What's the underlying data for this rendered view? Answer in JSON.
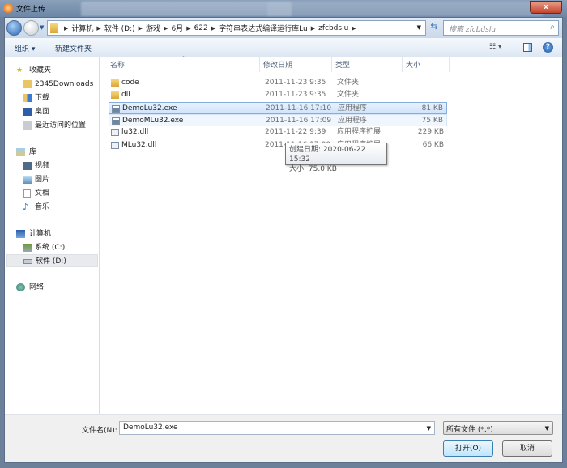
{
  "window": {
    "title": "文件上传",
    "close_glyph": "x"
  },
  "address": {
    "crumbs": [
      "计算机",
      "软件 (D:)",
      "游戏",
      "6月",
      "622",
      "字符串表达式编译运行库Lu",
      "zfcbdslu"
    ],
    "search_placeholder": "搜索 zfcbdslu"
  },
  "toolbar": {
    "organize": "组织 ▾",
    "new_folder": "新建文件夹"
  },
  "sidebar": {
    "favorites": {
      "label": "收藏夹",
      "items": [
        "2345Downloads",
        "下载",
        "桌面",
        "最近访问的位置"
      ]
    },
    "libraries": {
      "label": "库",
      "items": [
        "视频",
        "图片",
        "文档",
        "音乐"
      ]
    },
    "computer": {
      "label": "计算机",
      "items": [
        "系统 (C:)",
        "软件 (D:)"
      ],
      "selected": "软件 (D:)"
    },
    "network": {
      "label": "网络"
    }
  },
  "columns": {
    "name": "名称",
    "date": "修改日期",
    "type": "类型",
    "size": "大小"
  },
  "files": [
    {
      "name": "code",
      "date": "2011-11-23 9:35",
      "type": "文件夹",
      "size": "",
      "icon": "folder"
    },
    {
      "name": "dll",
      "date": "2011-11-23 9:35",
      "type": "文件夹",
      "size": "",
      "icon": "folder"
    },
    {
      "name": "DemoLu32.exe",
      "date": "2011-11-16 17:10",
      "type": "应用程序",
      "size": "81 KB",
      "icon": "exe",
      "selected": true
    },
    {
      "name": "DemoMLu32.exe",
      "date": "2011-11-16 17:09",
      "type": "应用程序",
      "size": "75 KB",
      "icon": "exe",
      "hover": true
    },
    {
      "name": "lu32.dll",
      "date": "2011-11-22 9:39",
      "type": "应用程序扩展",
      "size": "229 KB",
      "icon": "dll"
    },
    {
      "name": "MLu32.dll",
      "date": "2011-11-16 17:00",
      "type": "应用程序扩展",
      "size": "66 KB",
      "icon": "dll"
    }
  ],
  "tooltip": {
    "created": "创建日期: 2020-06-22 15:32",
    "size": "大小: 75.0 KB"
  },
  "bottom": {
    "filename_label": "文件名(N):",
    "filename_value": "DemoLu32.exe",
    "filter": "所有文件 (*.*)",
    "open": "打开(O)",
    "cancel": "取消"
  },
  "colors": {
    "selection": "#cfe3fa",
    "accent": "#3c7fb1"
  }
}
